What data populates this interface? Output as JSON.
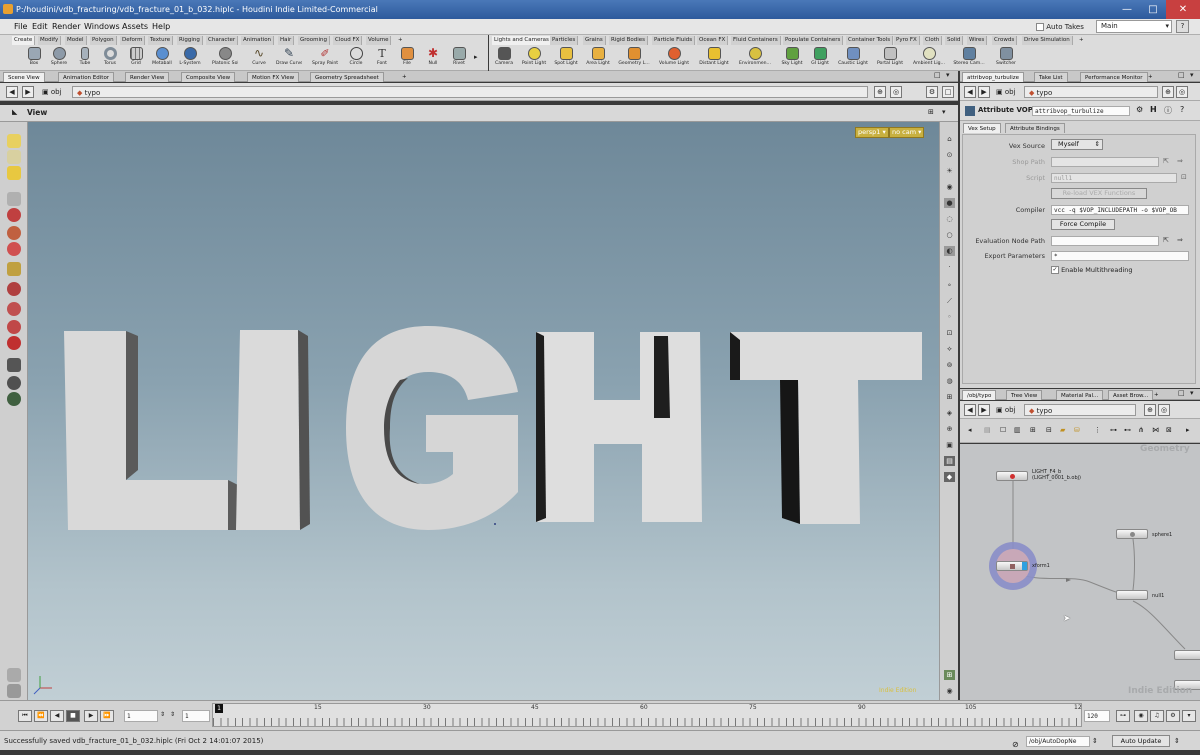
{
  "window": {
    "title": "P:/houdini/vdb_fracturing/vdb_fracture_01_b_032.hiplc - Houdini Indie Limited-Commercial"
  },
  "menu": [
    "File",
    "Edit",
    "Render",
    "Windows",
    "Assets",
    "Help"
  ],
  "topright": {
    "auto_takes": "Auto Takes",
    "desktop": "Main"
  },
  "shelf_left": {
    "tabs": [
      "Create",
      "Modify",
      "Model",
      "Polygon",
      "Deform",
      "Texture",
      "Rigging",
      "Character",
      "Animation",
      "Hair",
      "Grooming",
      "Cloud FX",
      "Volume"
    ],
    "tools": [
      "Box",
      "Sphere",
      "Tube",
      "Torus",
      "Grid",
      "Metaball",
      "L-System",
      "Platonic Sol...",
      "Curve",
      "Draw Curve",
      "Spray Paint",
      "Circle",
      "Font",
      "File",
      "Null",
      "Rivet"
    ]
  },
  "shelf_right": {
    "tabs": [
      "Lights and Cameras",
      "Particles",
      "Grains",
      "Rigid Bodies",
      "Particle Fluids",
      "Ocean FX",
      "Fluid Containers",
      "Populate Containers",
      "Container Tools",
      "Pyro FX",
      "Cloth",
      "Solid",
      "Wires",
      "Crowds",
      "Drive Simulation"
    ],
    "tools": [
      "Camera",
      "Point Light",
      "Spot Light",
      "Area Light",
      "Geometry L...",
      "Volume Light",
      "Distant Light",
      "Environmen...",
      "Sky Light",
      "GI Light",
      "Caustic Light",
      "Portal Light",
      "Ambient Lig...",
      "Stereo Cam...",
      "Switcher"
    ]
  },
  "scene_tabs": [
    "Scene View",
    "Animation Editor",
    "Render View",
    "Composite View",
    "Motion FX View",
    "Geometry Spreadsheet"
  ],
  "scene_path": {
    "obj": "obj",
    "node": "typo"
  },
  "view": {
    "label": "View",
    "persp": "persp1",
    "cam": "no cam",
    "watermark": "Indie Edition",
    "text": "LIGHT"
  },
  "param_tabs": [
    "attribvop_turbulize",
    "Take List",
    "Performance Monitor"
  ],
  "param_path": {
    "obj": "obj",
    "node": "typo"
  },
  "params": {
    "node_type": "Attribute VOP",
    "node_name": "attribvop_turbulize",
    "subtabs": [
      "Vex Setup",
      "Attribute Bindings"
    ],
    "vex_source_label": "Vex Source",
    "vex_source_value": "Myself",
    "shop_path_label": "Shop Path",
    "script_label": "Script",
    "script_value": "null1",
    "reload_label": "Re-load VEX Functions",
    "compiler_label": "Compiler",
    "compiler_value": "vcc -q $VOP_INCLUDEPATH -o $VOP_OB",
    "force_compile": "Force Compile",
    "eval_label": "Evaluation Node Path",
    "export_label": "Export Parameters",
    "export_value": "*",
    "multithread": "Enable Multithreading"
  },
  "net_tabs": [
    "/obj/typo",
    "Tree View",
    "Material Pal...",
    "Asset Brow..."
  ],
  "net_path": {
    "obj": "obj",
    "node": "typo"
  },
  "network": {
    "context": "Geometry",
    "watermark": "Indie Edition",
    "nodes": [
      {
        "name": "LIGHT_F4_b",
        "sub": "(LIGHT_0001_b.obj)"
      },
      {
        "name": "sphere1",
        "sub": ""
      },
      {
        "name": "xform1",
        "sub": ""
      },
      {
        "name": "null1",
        "sub": ""
      }
    ]
  },
  "timeline": {
    "frame": "1",
    "start": "1",
    "end": "120",
    "ticks": [
      "1",
      "15",
      "30",
      "45",
      "60",
      "75",
      "90",
      "105",
      "12"
    ]
  },
  "status": {
    "message": "Successfully saved vdb_fracture_01_b_032.hiplc (Fri Oct  2 14:01:07 2015)",
    "path": "/obj/AutoDopNe",
    "update": "Auto Update"
  }
}
